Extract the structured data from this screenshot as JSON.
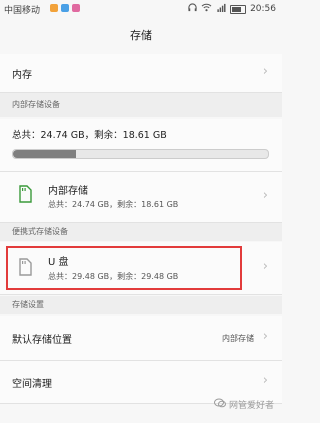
{
  "status": {
    "carrier": "中国移动",
    "time": "20:56"
  },
  "title": "存储",
  "storage_row": {
    "label": "内存"
  },
  "internal_section": {
    "title": "内部存储设备"
  },
  "usage": {
    "total_label": "总共：",
    "total": "24.74 GB",
    "free_label": "剩余：",
    "free": "18.61 GB",
    "used_fraction": 0.248
  },
  "internal_device": {
    "name": "内部存储",
    "total_label": "总共：",
    "total": "24.74 GB",
    "free_label": "剩余：",
    "free": "18.61 GB"
  },
  "portable_section": {
    "title": "便携式存储设备"
  },
  "usb": {
    "name": "U 盘",
    "total_label": "总共：",
    "total": "29.48 GB",
    "free_label": "剩余：",
    "free": "29.48 GB"
  },
  "storage_settings": {
    "title": "存储设置"
  },
  "default_location": {
    "label": "默认存储位置",
    "value": "内部存储"
  },
  "cleanup": {
    "label": "空间清理"
  },
  "watermark": "网管爱好者",
  "colors": {
    "highlight": "#e23b3b",
    "bar_fill": "#7f7f7f"
  }
}
